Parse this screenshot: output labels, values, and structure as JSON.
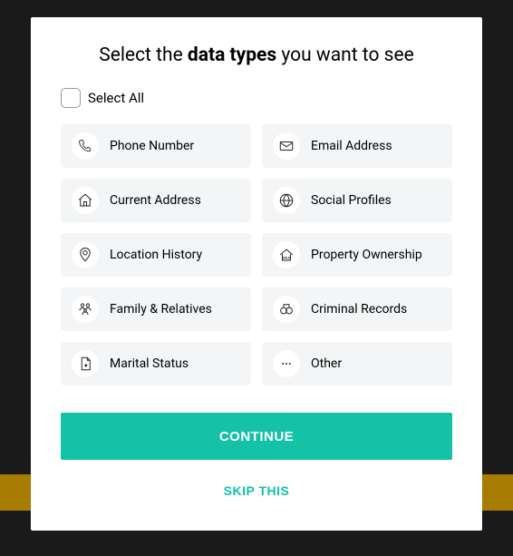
{
  "title_pre": "Select the ",
  "title_bold": "data types",
  "title_post": " you want to see",
  "select_all_label": "Select All",
  "options": {
    "phone": "Phone Number",
    "email": "Email Address",
    "current_address": "Current Address",
    "social": "Social Profiles",
    "location_history": "Location History",
    "property": "Property Ownership",
    "family": "Family & Relatives",
    "criminal": "Criminal Records",
    "marital": "Marital Status",
    "other": "Other"
  },
  "buttons": {
    "continue": "CONTINUE",
    "skip": "SKIP THIS"
  }
}
